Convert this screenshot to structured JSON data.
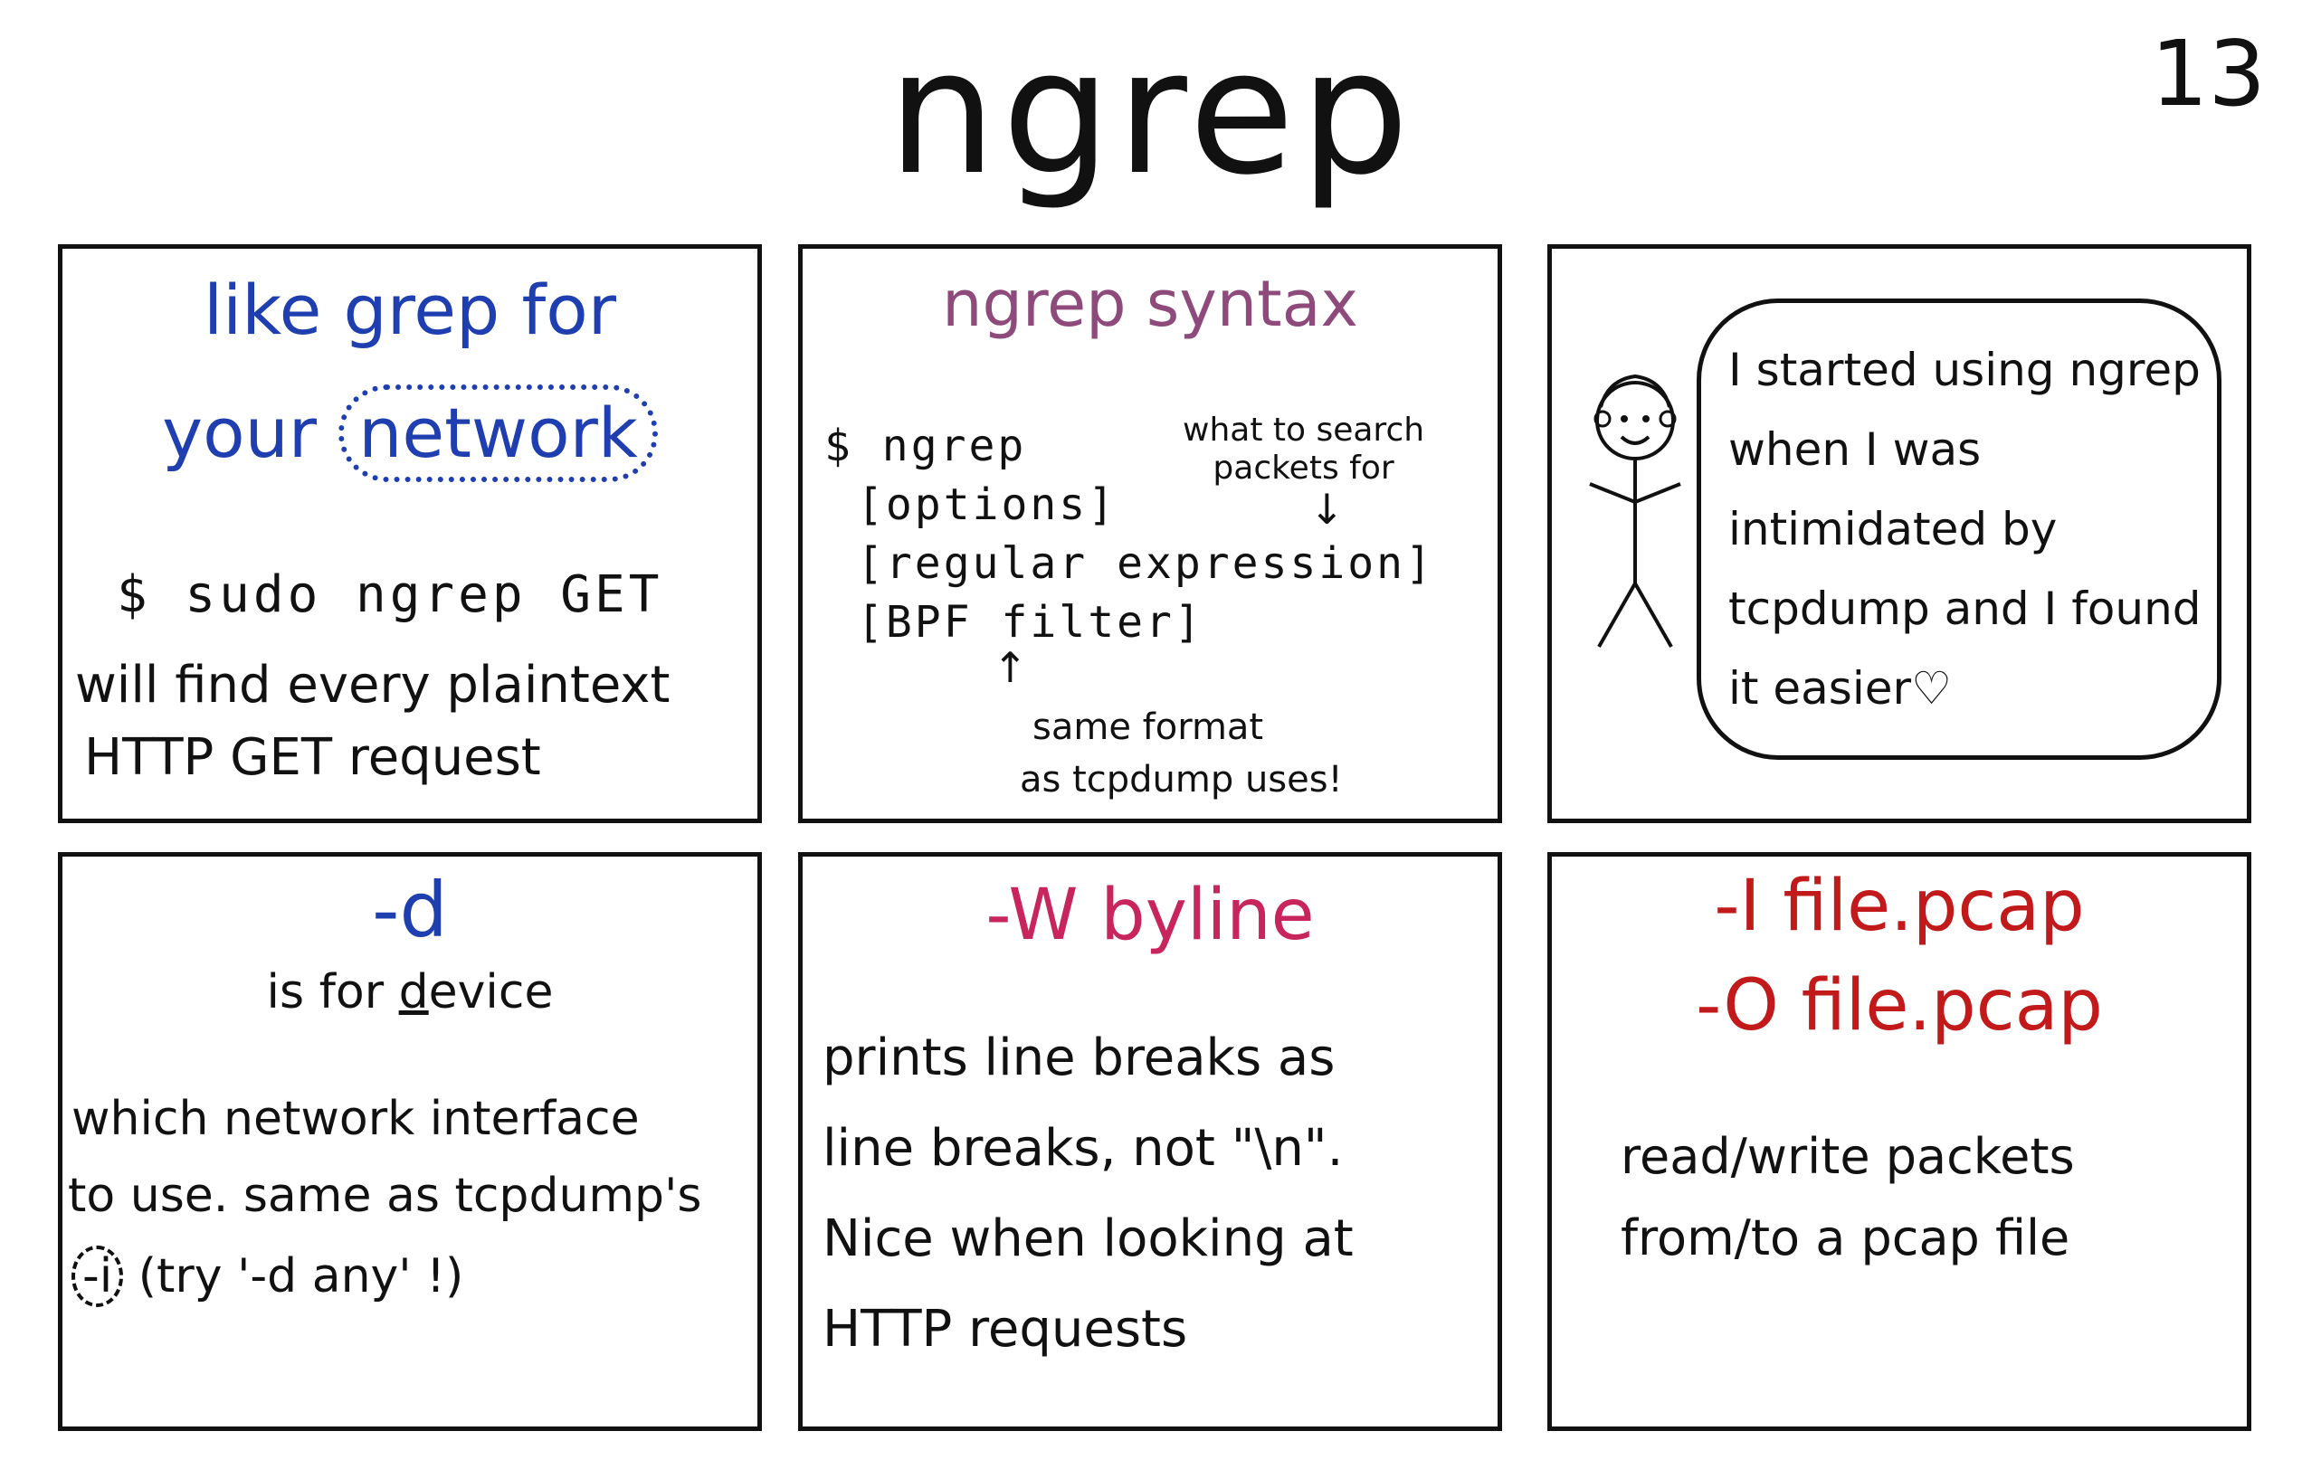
{
  "page": {
    "title": "ngrep",
    "page_number": "13"
  },
  "panel1": {
    "heading_line1": "like grep for",
    "heading_your": "your",
    "heading_network": "network",
    "command": "$ sudo ngrep GET",
    "desc_line1": "will find every plaintext",
    "desc_line2": "HTTP GET request"
  },
  "panel2": {
    "heading": "ngrep syntax",
    "code_line1": "$ ngrep",
    "code_line2": "[options]",
    "code_line3": "[regular expression]",
    "code_line4": "[BPF filter]",
    "annotation_top_line1": "what to search",
    "annotation_top_line2": "packets for",
    "annotation_bottom_line1": "same format",
    "annotation_bottom_line2": "as tcpdump uses!"
  },
  "panel3": {
    "speech": "I started using ngrep when I was intimidated by tcpdump and I found it easier",
    "heart": "♡"
  },
  "panel4": {
    "heading": "-d",
    "sub_prefix": "is for ",
    "sub_underlined": "d",
    "sub_suffix": "evice",
    "desc_line1": "which network interface",
    "desc_line2": "to use. same as tcpdump's",
    "desc_flag": "-i",
    "desc_line3_rest": "(try '-d any' !)"
  },
  "panel5": {
    "heading": "-W byline",
    "line1": "prints line breaks as",
    "line2": "line breaks, not \"\\n\".",
    "line3": "Nice when looking at",
    "line4": "HTTP requests"
  },
  "panel6": {
    "heading_line1": "-I file.pcap",
    "heading_line2": "-O file.pcap",
    "line1": "read/write packets",
    "line2": "from/to a pcap file"
  }
}
